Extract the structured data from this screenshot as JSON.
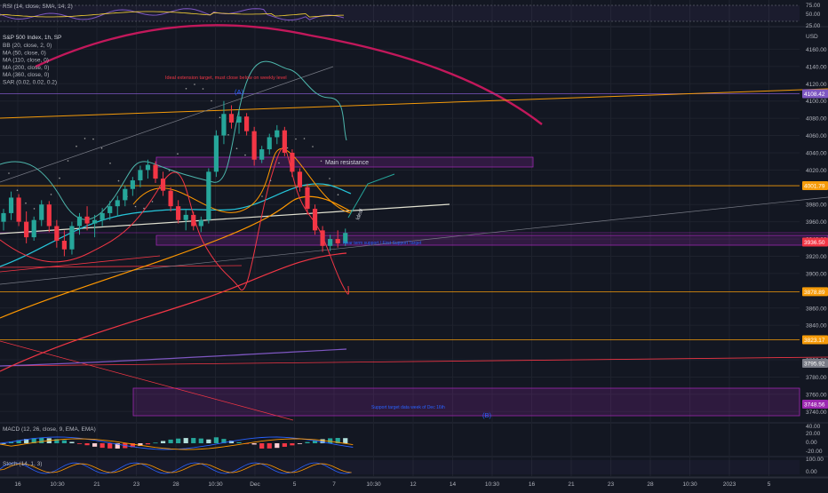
{
  "chart_data": {
    "type": "candlestick",
    "symbol": "S&P 500 Index, 1h, SP",
    "currency": "USD",
    "indicators": [
      "BB (20, close, 2, 0)",
      "MA (50, close, 0)",
      "MA (110, close, 0)",
      "MA (200, close, 0)",
      "MA (360, close, 0)",
      "SAR (0.02, 0.02, 0.2)"
    ],
    "y_range": [
      3730,
      4180
    ],
    "y_ticks": [
      4160,
      4140,
      4120,
      4100,
      4080,
      4060,
      4040,
      4020,
      3980,
      3960,
      3940,
      3920,
      3900,
      3860,
      3840,
      3800,
      3780,
      3760,
      3740
    ],
    "price_labels": [
      {
        "value": 4108.42,
        "text": "4108.42",
        "color": "#7e57c2"
      },
      {
        "value": 4001.79,
        "text": "4001.79",
        "color": "#f59b0a"
      },
      {
        "value": 3936.5,
        "text": "3936.50",
        "color": "#f23645"
      },
      {
        "value": 3878.89,
        "text": "3878.89",
        "color": "#f59b0a"
      },
      {
        "value": 3823.17,
        "text": "3823.17",
        "color": "#f59b0a"
      },
      {
        "value": 3795.92,
        "text": "3795.92",
        "color": "#787b86"
      },
      {
        "value": 3748.56,
        "text": "3748.56",
        "color": "#9c27b0"
      }
    ],
    "x_ticks": [
      "16",
      "10:30",
      "21",
      "23",
      "28",
      "10:30",
      "Dec",
      "5",
      "7",
      "10:30",
      "12",
      "14",
      "10:30",
      "16",
      "21",
      "23",
      "28",
      "10:30",
      "2023",
      "5"
    ],
    "annotations": [
      {
        "text": "Ideal extension target, must close below on weekly level",
        "color": "#f23645"
      },
      {
        "text": "(A)",
        "color": "#2962ff"
      },
      {
        "text": "Main resistance",
        "color": "#d1d4dc"
      },
      {
        "text": "Ideal",
        "color": "#d1d4dc"
      },
      {
        "text": "Near term support / First Support Target",
        "color": "#2962ff"
      },
      {
        "text": "Support target data week of Dec 16th",
        "color": "#2962ff"
      },
      {
        "text": "(B)",
        "color": "#2962ff"
      }
    ],
    "candles": [
      {
        "o": 3960,
        "h": 3975,
        "l": 3950,
        "c": 3970
      },
      {
        "o": 3970,
        "h": 3995,
        "l": 3962,
        "c": 3988
      },
      {
        "o": 3988,
        "h": 3992,
        "l": 3955,
        "c": 3960
      },
      {
        "o": 3960,
        "h": 3972,
        "l": 3935,
        "c": 3942
      },
      {
        "o": 3942,
        "h": 3966,
        "l": 3938,
        "c": 3962
      },
      {
        "o": 3962,
        "h": 3985,
        "l": 3955,
        "c": 3980
      },
      {
        "o": 3980,
        "h": 3984,
        "l": 3948,
        "c": 3955
      },
      {
        "o": 3955,
        "h": 3962,
        "l": 3930,
        "c": 3938
      },
      {
        "o": 3938,
        "h": 3950,
        "l": 3920,
        "c": 3928
      },
      {
        "o": 3928,
        "h": 3960,
        "l": 3922,
        "c": 3955
      },
      {
        "o": 3955,
        "h": 3970,
        "l": 3945,
        "c": 3966
      },
      {
        "o": 3966,
        "h": 3978,
        "l": 3950,
        "c": 3958
      },
      {
        "o": 3958,
        "h": 3968,
        "l": 3942,
        "c": 3962
      },
      {
        "o": 3962,
        "h": 3976,
        "l": 3955,
        "c": 3970
      },
      {
        "o": 3970,
        "h": 3984,
        "l": 3962,
        "c": 3978
      },
      {
        "o": 3978,
        "h": 3990,
        "l": 3966,
        "c": 3985
      },
      {
        "o": 3985,
        "h": 4002,
        "l": 3978,
        "c": 3998
      },
      {
        "o": 3998,
        "h": 4012,
        "l": 3990,
        "c": 4008
      },
      {
        "o": 4008,
        "h": 4025,
        "l": 4000,
        "c": 4020
      },
      {
        "o": 4020,
        "h": 4032,
        "l": 4010,
        "c": 4026
      },
      {
        "o": 4026,
        "h": 4030,
        "l": 4005,
        "c": 4010
      },
      {
        "o": 4010,
        "h": 4018,
        "l": 3990,
        "c": 3996
      },
      {
        "o": 3996,
        "h": 4000,
        "l": 3972,
        "c": 3978
      },
      {
        "o": 3978,
        "h": 3985,
        "l": 3958,
        "c": 3962
      },
      {
        "o": 3962,
        "h": 3974,
        "l": 3950,
        "c": 3968
      },
      {
        "o": 3968,
        "h": 3972,
        "l": 3950,
        "c": 3955
      },
      {
        "o": 3955,
        "h": 3966,
        "l": 3948,
        "c": 3962
      },
      {
        "o": 3962,
        "h": 4022,
        "l": 3958,
        "c": 4018
      },
      {
        "o": 4018,
        "h": 4066,
        "l": 4012,
        "c": 4060
      },
      {
        "o": 4060,
        "h": 4100,
        "l": 4050,
        "c": 4085
      },
      {
        "o": 4085,
        "h": 4095,
        "l": 4068,
        "c": 4075
      },
      {
        "o": 4075,
        "h": 4090,
        "l": 4062,
        "c": 4082
      },
      {
        "o": 4082,
        "h": 4086,
        "l": 4060,
        "c": 4065
      },
      {
        "o": 4065,
        "h": 4070,
        "l": 4025,
        "c": 4032
      },
      {
        "o": 4032,
        "h": 4048,
        "l": 4028,
        "c": 4044
      },
      {
        "o": 4044,
        "h": 4062,
        "l": 4038,
        "c": 4058
      },
      {
        "o": 4058,
        "h": 4072,
        "l": 4050,
        "c": 4066
      },
      {
        "o": 4066,
        "h": 4070,
        "l": 4036,
        "c": 4040
      },
      {
        "o": 4040,
        "h": 4044,
        "l": 4012,
        "c": 4018
      },
      {
        "o": 4018,
        "h": 4022,
        "l": 3995,
        "c": 4000
      },
      {
        "o": 4000,
        "h": 4004,
        "l": 3968,
        "c": 3975
      },
      {
        "o": 3975,
        "h": 3980,
        "l": 3945,
        "c": 3950
      },
      {
        "o": 3950,
        "h": 3955,
        "l": 3925,
        "c": 3932
      },
      {
        "o": 3932,
        "h": 3945,
        "l": 3926,
        "c": 3940
      },
      {
        "o": 3940,
        "h": 3950,
        "l": 3930,
        "c": 3935
      },
      {
        "o": 3935,
        "h": 3952,
        "l": 3932,
        "c": 3947
      }
    ],
    "pane_labels": {
      "rsi": "RSI (14, close, SMA, 14, 2)",
      "macd": "MACD (12, 26, close, 9, EMA, EMA)",
      "stoch": "Stoch (14, 1, 3)"
    },
    "rsi_ticks": [
      "75.00",
      "50.00",
      "25.00"
    ],
    "macd_ticks": [
      "40.00",
      "20.00",
      "0.00",
      "-20.00"
    ],
    "stoch_ticks": [
      "100.00",
      "0.00"
    ],
    "colors": {
      "background": "#131722",
      "up": "#26a69a",
      "down": "#f23645",
      "bb": "#4db6ac",
      "ma50": "#ff9800",
      "ma110": "#fdd835",
      "ma200": "#f23645",
      "ma360": "#7e57c2",
      "sar": "#9e9e9e",
      "zone": "#9c27b0",
      "arc": "#c2185b",
      "hline_orange": "#f59b0a",
      "hline_purple": "#7e57c2"
    }
  }
}
